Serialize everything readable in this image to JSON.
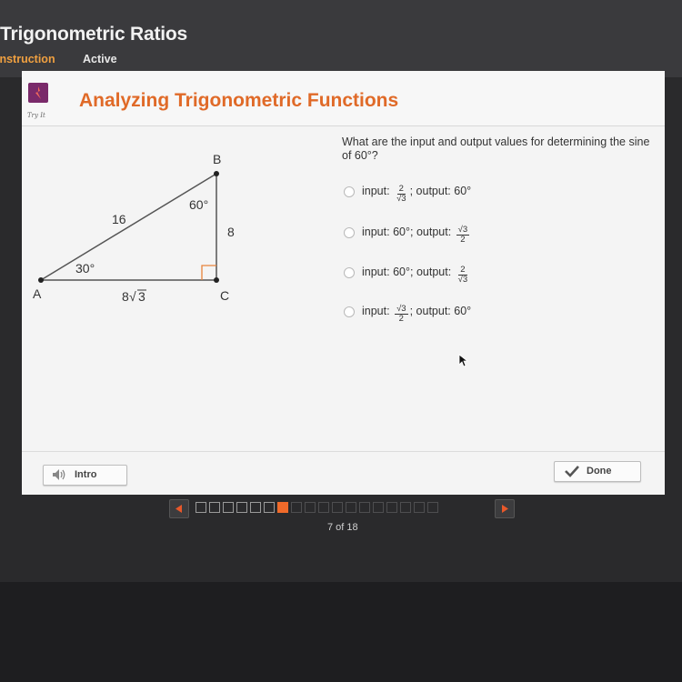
{
  "course": {
    "title": "Trigonometric Ratios",
    "tabs": [
      {
        "label": "Instruction",
        "state": "selected"
      },
      {
        "label": "Active",
        "state": "normal"
      }
    ]
  },
  "lesson": {
    "icon_label": "Try It",
    "title": "Analyzing Trigonometric Functions"
  },
  "diagram": {
    "vertices": {
      "a": "A",
      "b": "B",
      "c": "C"
    },
    "angle_a": "30°",
    "angle_b": "60°",
    "side_ab": "16",
    "side_bc": "8",
    "side_ac_coeff": "8",
    "side_ac_radicand": "3"
  },
  "question": {
    "text": "What are the input and output values for determining the sine of 60°?",
    "options": [
      {
        "input_label": "input:",
        "input_frac_num": "2",
        "input_frac_den": "√3",
        "sep": ";",
        "output_label": "output:",
        "output_value": "60°"
      },
      {
        "input_label": "input:",
        "input_value": "60°",
        "sep": ";",
        "output_label": "output:",
        "output_frac_num": "√3",
        "output_frac_den": "2"
      },
      {
        "input_label": "input:",
        "input_value": "60°",
        "sep": ";",
        "output_label": "output:",
        "output_frac_num": "2",
        "output_frac_den": "√3"
      },
      {
        "input_label": "input:",
        "input_frac_num": "√3",
        "input_frac_den": "2",
        "sep": ";",
        "output_label": "output:",
        "output_value": "60°"
      }
    ]
  },
  "footer": {
    "intro_label": "Intro",
    "done_label": "Done"
  },
  "pagination": {
    "current": 7,
    "total": 18,
    "label": "7 of 18"
  },
  "colors": {
    "accent": "#e06a28",
    "current_page": "#f06a2a",
    "icon_bg": "#7a2a6a"
  }
}
